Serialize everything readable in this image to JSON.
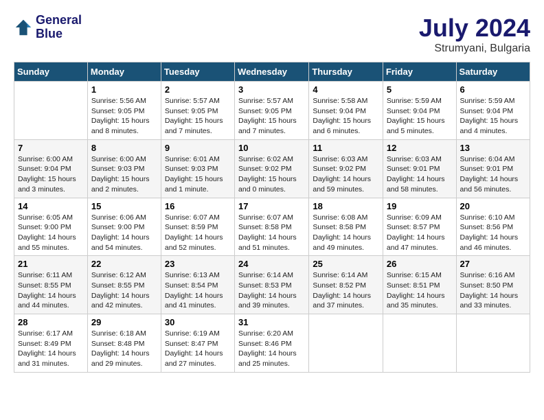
{
  "header": {
    "logo_line1": "General",
    "logo_line2": "Blue",
    "month_year": "July 2024",
    "location": "Strumyani, Bulgaria"
  },
  "weekdays": [
    "Sunday",
    "Monday",
    "Tuesday",
    "Wednesday",
    "Thursday",
    "Friday",
    "Saturday"
  ],
  "weeks": [
    [
      {
        "day": "",
        "info": ""
      },
      {
        "day": "1",
        "info": "Sunrise: 5:56 AM\nSunset: 9:05 PM\nDaylight: 15 hours\nand 8 minutes."
      },
      {
        "day": "2",
        "info": "Sunrise: 5:57 AM\nSunset: 9:05 PM\nDaylight: 15 hours\nand 7 minutes."
      },
      {
        "day": "3",
        "info": "Sunrise: 5:57 AM\nSunset: 9:05 PM\nDaylight: 15 hours\nand 7 minutes."
      },
      {
        "day": "4",
        "info": "Sunrise: 5:58 AM\nSunset: 9:04 PM\nDaylight: 15 hours\nand 6 minutes."
      },
      {
        "day": "5",
        "info": "Sunrise: 5:59 AM\nSunset: 9:04 PM\nDaylight: 15 hours\nand 5 minutes."
      },
      {
        "day": "6",
        "info": "Sunrise: 5:59 AM\nSunset: 9:04 PM\nDaylight: 15 hours\nand 4 minutes."
      }
    ],
    [
      {
        "day": "7",
        "info": "Sunrise: 6:00 AM\nSunset: 9:04 PM\nDaylight: 15 hours\nand 3 minutes."
      },
      {
        "day": "8",
        "info": "Sunrise: 6:00 AM\nSunset: 9:03 PM\nDaylight: 15 hours\nand 2 minutes."
      },
      {
        "day": "9",
        "info": "Sunrise: 6:01 AM\nSunset: 9:03 PM\nDaylight: 15 hours\nand 1 minute."
      },
      {
        "day": "10",
        "info": "Sunrise: 6:02 AM\nSunset: 9:02 PM\nDaylight: 15 hours\nand 0 minutes."
      },
      {
        "day": "11",
        "info": "Sunrise: 6:03 AM\nSunset: 9:02 PM\nDaylight: 14 hours\nand 59 minutes."
      },
      {
        "day": "12",
        "info": "Sunrise: 6:03 AM\nSunset: 9:01 PM\nDaylight: 14 hours\nand 58 minutes."
      },
      {
        "day": "13",
        "info": "Sunrise: 6:04 AM\nSunset: 9:01 PM\nDaylight: 14 hours\nand 56 minutes."
      }
    ],
    [
      {
        "day": "14",
        "info": "Sunrise: 6:05 AM\nSunset: 9:00 PM\nDaylight: 14 hours\nand 55 minutes."
      },
      {
        "day": "15",
        "info": "Sunrise: 6:06 AM\nSunset: 9:00 PM\nDaylight: 14 hours\nand 54 minutes."
      },
      {
        "day": "16",
        "info": "Sunrise: 6:07 AM\nSunset: 8:59 PM\nDaylight: 14 hours\nand 52 minutes."
      },
      {
        "day": "17",
        "info": "Sunrise: 6:07 AM\nSunset: 8:58 PM\nDaylight: 14 hours\nand 51 minutes."
      },
      {
        "day": "18",
        "info": "Sunrise: 6:08 AM\nSunset: 8:58 PM\nDaylight: 14 hours\nand 49 minutes."
      },
      {
        "day": "19",
        "info": "Sunrise: 6:09 AM\nSunset: 8:57 PM\nDaylight: 14 hours\nand 47 minutes."
      },
      {
        "day": "20",
        "info": "Sunrise: 6:10 AM\nSunset: 8:56 PM\nDaylight: 14 hours\nand 46 minutes."
      }
    ],
    [
      {
        "day": "21",
        "info": "Sunrise: 6:11 AM\nSunset: 8:55 PM\nDaylight: 14 hours\nand 44 minutes."
      },
      {
        "day": "22",
        "info": "Sunrise: 6:12 AM\nSunset: 8:55 PM\nDaylight: 14 hours\nand 42 minutes."
      },
      {
        "day": "23",
        "info": "Sunrise: 6:13 AM\nSunset: 8:54 PM\nDaylight: 14 hours\nand 41 minutes."
      },
      {
        "day": "24",
        "info": "Sunrise: 6:14 AM\nSunset: 8:53 PM\nDaylight: 14 hours\nand 39 minutes."
      },
      {
        "day": "25",
        "info": "Sunrise: 6:14 AM\nSunset: 8:52 PM\nDaylight: 14 hours\nand 37 minutes."
      },
      {
        "day": "26",
        "info": "Sunrise: 6:15 AM\nSunset: 8:51 PM\nDaylight: 14 hours\nand 35 minutes."
      },
      {
        "day": "27",
        "info": "Sunrise: 6:16 AM\nSunset: 8:50 PM\nDaylight: 14 hours\nand 33 minutes."
      }
    ],
    [
      {
        "day": "28",
        "info": "Sunrise: 6:17 AM\nSunset: 8:49 PM\nDaylight: 14 hours\nand 31 minutes."
      },
      {
        "day": "29",
        "info": "Sunrise: 6:18 AM\nSunset: 8:48 PM\nDaylight: 14 hours\nand 29 minutes."
      },
      {
        "day": "30",
        "info": "Sunrise: 6:19 AM\nSunset: 8:47 PM\nDaylight: 14 hours\nand 27 minutes."
      },
      {
        "day": "31",
        "info": "Sunrise: 6:20 AM\nSunset: 8:46 PM\nDaylight: 14 hours\nand 25 minutes."
      },
      {
        "day": "",
        "info": ""
      },
      {
        "day": "",
        "info": ""
      },
      {
        "day": "",
        "info": ""
      }
    ]
  ]
}
